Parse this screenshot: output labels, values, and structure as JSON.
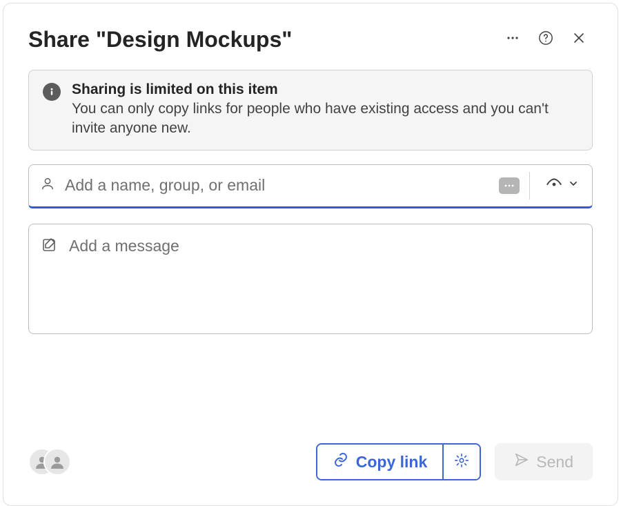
{
  "header": {
    "title": "Share \"Design Mockups\""
  },
  "banner": {
    "heading": "Sharing is limited on this item",
    "body": "You can only copy links for people who have existing access and you can't invite anyone new."
  },
  "recipient_input": {
    "placeholder": "Add a name, group, or email",
    "value": ""
  },
  "message_input": {
    "placeholder": "Add a message",
    "value": ""
  },
  "footer": {
    "copy_link_label": "Copy link",
    "send_label": "Send"
  }
}
